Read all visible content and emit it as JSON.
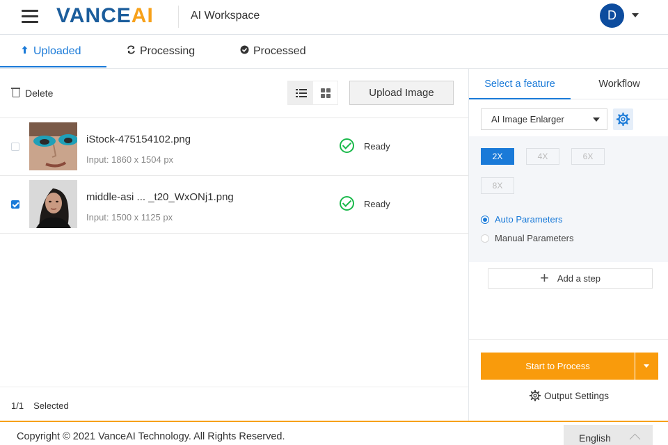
{
  "header": {
    "logo_vance": "VANCE",
    "logo_ai": "AI",
    "workspace_title": "AI Workspace",
    "avatar_initial": "D"
  },
  "tabs": [
    {
      "label": "Uploaded",
      "icon": "upload-arrow-icon",
      "active": true
    },
    {
      "label": "Processing",
      "icon": "refresh-icon",
      "active": false
    },
    {
      "label": "Processed",
      "icon": "check-circle-icon",
      "active": false
    }
  ],
  "toolbar": {
    "delete_label": "Delete",
    "upload_label": "Upload Image",
    "view_mode": "list"
  },
  "files": [
    {
      "name": "iStock-475154102.png",
      "meta": "Input: 1860 x 1504 px",
      "status": "Ready",
      "checked": false
    },
    {
      "name": "middle-asi ... _t20_WxONj1.png",
      "meta": "Input: 1500 x 1125 px",
      "status": "Ready",
      "checked": true
    }
  ],
  "selection": {
    "count": "1/1",
    "label": "Selected"
  },
  "right_panel": {
    "tab_feature": "Select a feature",
    "tab_workflow": "Workflow",
    "feature_value": "AI Image Enlarger",
    "scales": [
      "2X",
      "4X",
      "6X",
      "8X"
    ],
    "active_scale": "2X",
    "param_auto": "Auto Parameters",
    "param_manual": "Manual Parameters",
    "add_step": "Add a step",
    "start_label": "Start to Process",
    "output_settings": "Output Settings"
  },
  "footer": {
    "copyright": "Copyright © 2021 VanceAI Technology. All Rights Reserved.",
    "language": "English"
  },
  "colors": {
    "accent_blue": "#1a7ad8",
    "brand_blue": "#1b5d9c",
    "brand_orange": "#f7a11a",
    "process_orange": "#f99b0c",
    "success_green": "#19b94a"
  }
}
